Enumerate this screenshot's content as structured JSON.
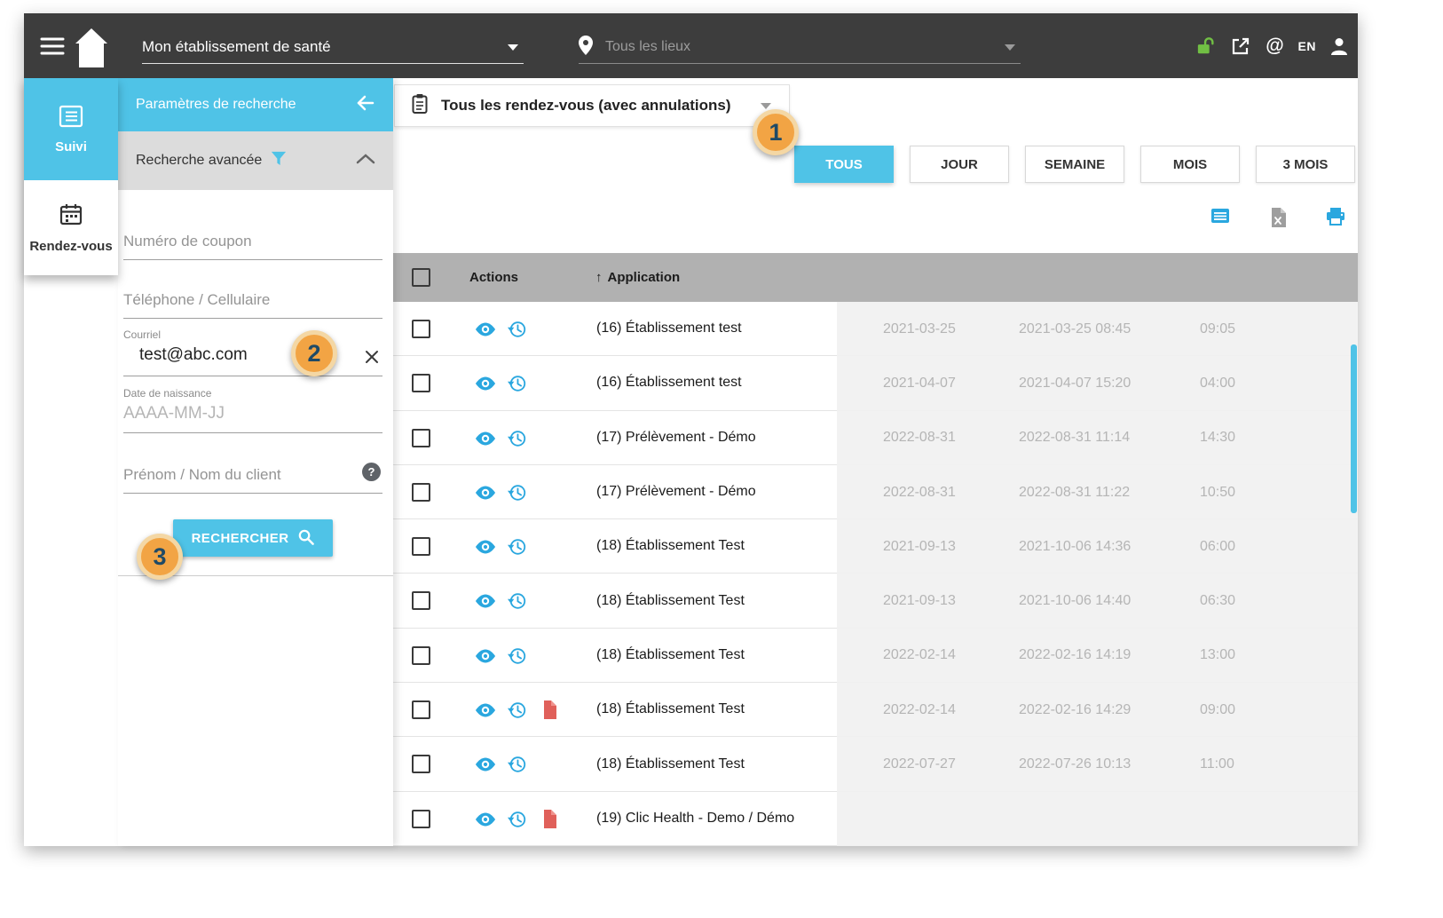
{
  "colors": {
    "accent": "#4fc3e7",
    "topbar_bg": "#3d3d3d",
    "table_header_bg": "#b1b1b1",
    "callout_orange": "#f2a444",
    "doc_red": "#e0605a",
    "lock_green": "#71bf44",
    "icon_blue": "#2aa7df"
  },
  "topbar": {
    "establishment_select": "Mon établissement de santé",
    "location_select": "Tous les lieux",
    "at_glyph": "@",
    "language": "EN"
  },
  "rail": {
    "items": [
      {
        "label": "Suivi"
      },
      {
        "label": "Rendez-vous"
      }
    ]
  },
  "search_panel": {
    "title": "Paramètres de recherche",
    "advanced_label": "Recherche avancée",
    "coupon_placeholder": "Numéro de coupon",
    "phone_placeholder": "Téléphone / Cellulaire",
    "email_label": "Courriel",
    "email_value": "test@abc.com",
    "dob_label": "Date de naissance",
    "dob_placeholder": "AAAA-MM-JJ",
    "name_placeholder": "Prénom / Nom du client",
    "help_glyph": "?",
    "search_button_label": "RECHERCHER"
  },
  "main": {
    "appointment_select": "Tous les rendez-vous (avec annulations)",
    "range_buttons": [
      {
        "label": "TOUS",
        "active": true
      },
      {
        "label": "JOUR",
        "active": false
      },
      {
        "label": "SEMAINE",
        "active": false
      },
      {
        "label": "MOIS",
        "active": false
      },
      {
        "label": "3 MOIS",
        "active": false
      }
    ],
    "table": {
      "sort_glyph": "↑",
      "headers": {
        "actions": "Actions",
        "application": "Application"
      },
      "rows": [
        {
          "application": "(16) Établissement test",
          "has_document": false,
          "date": "2021-03-25",
          "datetime": "2021-03-25 08:45",
          "duration": "09:05"
        },
        {
          "application": "(16) Établissement test",
          "has_document": false,
          "date": "2021-04-07",
          "datetime": "2021-04-07 15:20",
          "duration": "04:00"
        },
        {
          "application": "(17) Prélèvement - Démo",
          "has_document": false,
          "date": "2022-08-31",
          "datetime": "2022-08-31 11:14",
          "duration": "14:30"
        },
        {
          "application": "(17) Prélèvement - Démo",
          "has_document": false,
          "date": "2022-08-31",
          "datetime": "2022-08-31 11:22",
          "duration": "10:50"
        },
        {
          "application": "(18) Établissement Test",
          "has_document": false,
          "date": "2021-09-13",
          "datetime": "2021-10-06 14:36",
          "duration": "06:00"
        },
        {
          "application": "(18) Établissement Test",
          "has_document": false,
          "date": "2021-09-13",
          "datetime": "2021-10-06 14:40",
          "duration": "06:30"
        },
        {
          "application": "(18) Établissement Test",
          "has_document": false,
          "date": "2022-02-14",
          "datetime": "2022-02-16 14:19",
          "duration": "13:00"
        },
        {
          "application": "(18) Établissement Test",
          "has_document": true,
          "date": "2022-02-14",
          "datetime": "2022-02-16 14:29",
          "duration": "09:00"
        },
        {
          "application": "(18) Établissement Test",
          "has_document": false,
          "date": "2022-07-27",
          "datetime": "2022-07-26 10:13",
          "duration": "11:00"
        },
        {
          "application": "(19) Clic Health - Demo / Démo",
          "has_document": true,
          "date": "",
          "datetime": "",
          "duration": ""
        }
      ]
    }
  },
  "annotations": [
    {
      "label": "1"
    },
    {
      "label": "2"
    },
    {
      "label": "3"
    }
  ]
}
